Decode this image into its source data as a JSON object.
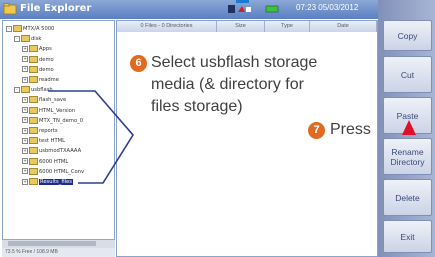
{
  "window": {
    "title": "File Explorer",
    "status_text": "07:23 05/03/2012"
  },
  "columns": [
    {
      "label": "0 Files - 0 Directories"
    },
    {
      "label": "Size"
    },
    {
      "label": "Type"
    },
    {
      "label": "Date"
    }
  ],
  "tree": [
    {
      "label": "MTX/A 5000",
      "level": 0,
      "expand": "-"
    },
    {
      "label": "disk",
      "level": 1,
      "expand": "-"
    },
    {
      "label": "Apps",
      "level": 2,
      "expand": "+"
    },
    {
      "label": "demo",
      "level": 2,
      "expand": "+"
    },
    {
      "label": "demo",
      "level": 2,
      "expand": "+"
    },
    {
      "label": "readme",
      "level": 2,
      "expand": "+"
    },
    {
      "label": "usbflash",
      "level": 1,
      "expand": "-"
    },
    {
      "label": "flash_save",
      "level": 2,
      "expand": "+"
    },
    {
      "label": "HTML_Version",
      "level": 2,
      "expand": "+"
    },
    {
      "label": "MTX_TN_demo_0",
      "level": 2,
      "expand": "+"
    },
    {
      "label": "reports",
      "level": 2,
      "expand": "+"
    },
    {
      "label": "test HTML",
      "level": 2,
      "expand": "+"
    },
    {
      "label": "usbmodTXAAAA",
      "level": 2,
      "expand": "+"
    },
    {
      "label": "6000 HTML",
      "level": 2,
      "expand": "+"
    },
    {
      "label": "6000 HTML_Conv",
      "level": 2,
      "expand": "+"
    },
    {
      "label": "Results_files",
      "level": 2,
      "expand": "+",
      "selected": true
    }
  ],
  "status_bar": "73.5 % Free / 108.9 MB",
  "side_buttons": [
    {
      "label": "Copy"
    },
    {
      "label": "Cut"
    },
    {
      "label": "Paste"
    },
    {
      "label": "Rename\nDirectory"
    },
    {
      "label": "Delete"
    },
    {
      "label": "Exit"
    }
  ],
  "callouts": {
    "step6_number": "6",
    "step6_line1": "Select usbflash storage",
    "step6_line2": "media (& directory for",
    "step6_line3": "files storage)",
    "step7_number": "7",
    "step7_text": "Press"
  },
  "colors": {
    "callout_badge": "#e06a20",
    "arrow": "#e0102a",
    "line": "#2c3f8f",
    "selection": "#1c2c8c"
  }
}
